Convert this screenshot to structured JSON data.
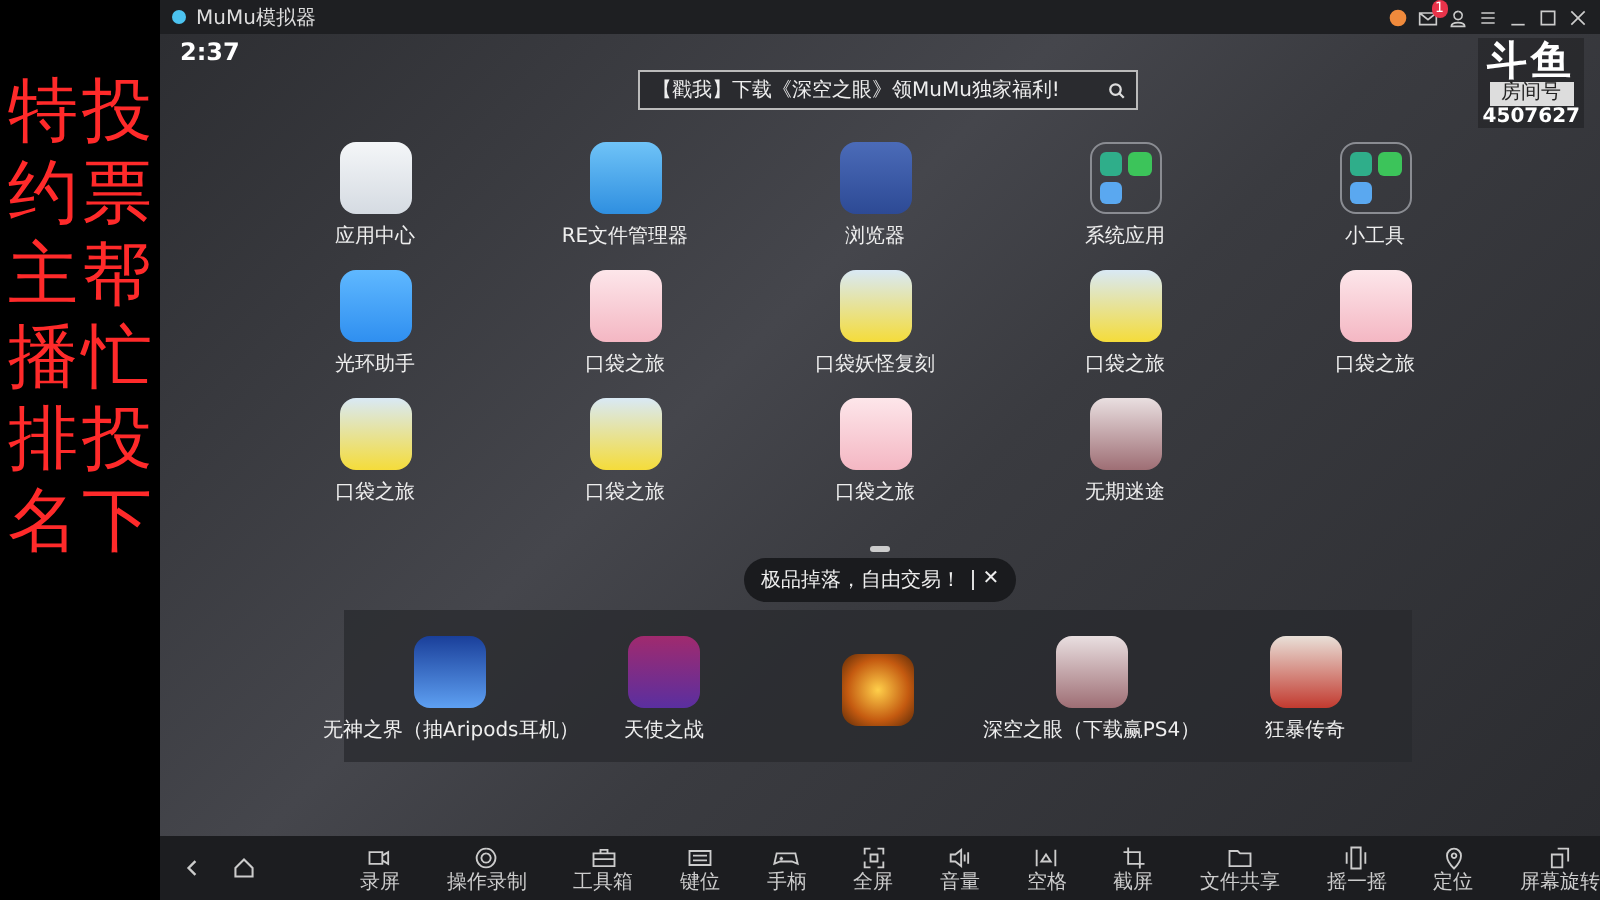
{
  "overlay": {
    "columns": [
      "特约主播排名",
      "投票帮忙投下"
    ],
    "logo": "斗鱼",
    "room_label": "房间号",
    "room_number": "4507627"
  },
  "window": {
    "title": "MuMu模拟器",
    "mail_badge": "1"
  },
  "status_bar": {
    "time": "2:37"
  },
  "search": {
    "value": "【戳我】下载《深空之眼》领MuMu独家福利!"
  },
  "apps": [
    {
      "label": "应用中心",
      "kind": "store"
    },
    {
      "label": "RE文件管理器",
      "kind": "files"
    },
    {
      "label": "浏览器",
      "kind": "browser"
    },
    {
      "label": "系统应用",
      "kind": "folder"
    },
    {
      "label": "小工具",
      "kind": "folder"
    },
    {
      "label": "光环助手",
      "kind": "halo"
    },
    {
      "label": "口袋之旅",
      "kind": "pink"
    },
    {
      "label": "口袋妖怪复刻",
      "kind": "yellow"
    },
    {
      "label": "口袋之旅",
      "kind": "yellow"
    },
    {
      "label": "口袋之旅",
      "kind": "pink"
    },
    {
      "label": "口袋之旅",
      "kind": "yellow"
    },
    {
      "label": "口袋之旅",
      "kind": "yellow"
    },
    {
      "label": "口袋之旅",
      "kind": "pink"
    },
    {
      "label": "无期迷途",
      "kind": "portrait"
    }
  ],
  "tooltip": {
    "text": "极品掉落，自由交易！",
    "close": "✕"
  },
  "dock": [
    {
      "label": "无神之界（抽Aripods耳机）",
      "kind": "blue"
    },
    {
      "label": "天使之战",
      "kind": "purple"
    },
    {
      "kind": "fire"
    },
    {
      "label": "深空之眼（下载赢PS4）",
      "kind": "portrait"
    },
    {
      "label": "狂暴传奇",
      "kind": "red"
    }
  ],
  "toolbar": [
    {
      "label": "录屏",
      "kind": "camera"
    },
    {
      "label": "操作录制",
      "kind": "macro"
    },
    {
      "label": "工具箱",
      "kind": "toolbox"
    },
    {
      "label": "键位",
      "kind": "keyboard"
    },
    {
      "label": "手柄",
      "kind": "gamepad"
    },
    {
      "label": "全屏",
      "kind": "fullscreen"
    },
    {
      "label": "音量",
      "kind": "volume"
    },
    {
      "label": "空格",
      "kind": "shake"
    },
    {
      "label": "截屏",
      "kind": "crop"
    },
    {
      "label": "文件共享",
      "kind": "folder"
    },
    {
      "label": "摇一摇",
      "kind": "phone"
    },
    {
      "label": "定位",
      "kind": "pin"
    },
    {
      "label": "屏幕旋转",
      "kind": "rotate"
    }
  ]
}
